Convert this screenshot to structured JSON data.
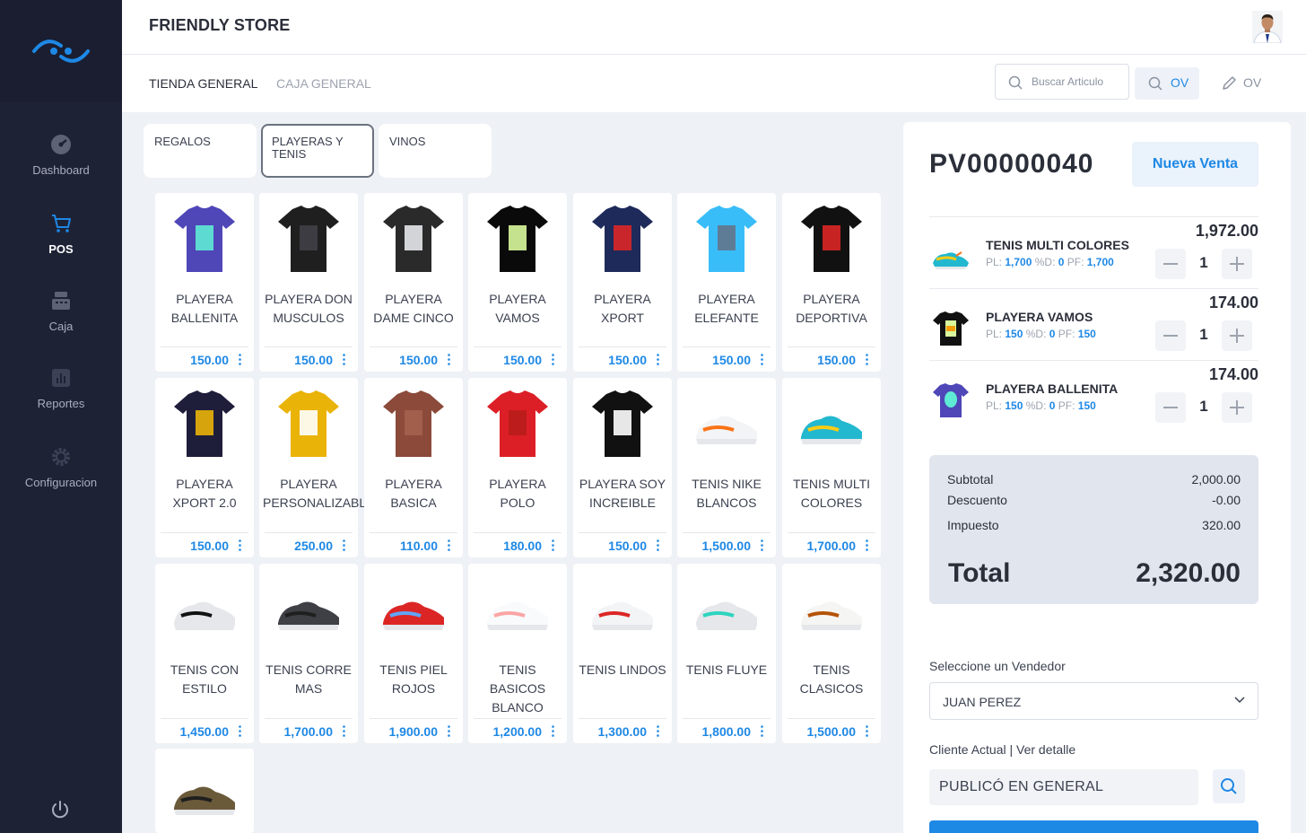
{
  "app": {
    "store_name": "FRIENDLY STORE"
  },
  "sidebar": {
    "items": [
      {
        "label": "Dashboard",
        "icon": "dashboard-icon"
      },
      {
        "label": "POS",
        "icon": "cart-icon"
      },
      {
        "label": "Caja",
        "icon": "cash-register-icon"
      },
      {
        "label": "Reportes",
        "icon": "reports-icon"
      },
      {
        "label": "Configuracion",
        "icon": "gear-icon"
      }
    ],
    "active": "POS"
  },
  "breadcrumb": {
    "store": "TIENDA GENERAL",
    "register": "CAJA GENERAL"
  },
  "toolbar": {
    "search_placeholder": "Buscar Articulo",
    "ov_search": "OV",
    "ov_edit": "OV"
  },
  "categories": [
    {
      "label": "REGALOS"
    },
    {
      "label": "PLAYERAS Y TENIS"
    },
    {
      "label": "VINOS"
    }
  ],
  "products": [
    {
      "name": "PLAYERA BALLENITA",
      "price": "150.00"
    },
    {
      "name": "PLAYERA DON MUSCULOS",
      "price": "150.00"
    },
    {
      "name": "PLAYERA DAME CINCO",
      "price": "150.00"
    },
    {
      "name": "PLAYERA VAMOS",
      "price": "150.00"
    },
    {
      "name": "PLAYERA XPORT",
      "price": "150.00"
    },
    {
      "name": "PLAYERA ELEFANTE",
      "price": "150.00"
    },
    {
      "name": "PLAYERA DEPORTIVA",
      "price": "150.00"
    },
    {
      "name": "PLAYERA XPORT 2.0",
      "price": "150.00"
    },
    {
      "name": "PLAYERA PERSONALIZABLE",
      "price": "250.00"
    },
    {
      "name": "PLAYERA BASICA",
      "price": "110.00"
    },
    {
      "name": "PLAYERA POLO",
      "price": "180.00"
    },
    {
      "name": "PLAYERA SOY INCREIBLE",
      "price": "150.00"
    },
    {
      "name": "TENIS NIKE BLANCOS",
      "price": "1,500.00"
    },
    {
      "name": "TENIS MULTI COLORES",
      "price": "1,700.00"
    },
    {
      "name": "TENIS CON ESTILO",
      "price": "1,450.00"
    },
    {
      "name": "TENIS CORRE MAS",
      "price": "1,700.00"
    },
    {
      "name": "TENIS PIEL ROJOS",
      "price": "1,900.00"
    },
    {
      "name": "TENIS BASICOS BLANCO",
      "price": "1,200.00"
    },
    {
      "name": "TENIS LINDOS",
      "price": "1,300.00"
    },
    {
      "name": "TENIS FLUYE",
      "price": "1,800.00"
    },
    {
      "name": "TENIS CLASICOS",
      "price": "1,500.00"
    },
    {
      "name": "",
      "price": ""
    }
  ],
  "order": {
    "id": "PV00000040",
    "new_sale_label": "Nueva Venta",
    "items": [
      {
        "name": "TENIS MULTI COLORES",
        "total": "1,972.00",
        "pl_label": "PL:",
        "pl": "1,700",
        "d_label": "%D:",
        "d": "0",
        "pf_label": "PF:",
        "pf": "1,700",
        "qty": "1"
      },
      {
        "name": "PLAYERA VAMOS",
        "total": "174.00",
        "pl_label": "PL:",
        "pl": "150",
        "d_label": "%D:",
        "d": "0",
        "pf_label": "PF:",
        "pf": "150",
        "qty": "1"
      },
      {
        "name": "PLAYERA BALLENITA",
        "total": "174.00",
        "pl_label": "PL:",
        "pl": "150",
        "d_label": "%D:",
        "d": "0",
        "pf_label": "PF:",
        "pf": "150",
        "qty": "1"
      }
    ],
    "summary": {
      "subtotal_label": "Subtotal",
      "subtotal": "2,000.00",
      "discount_label": "Descuento",
      "discount": "-0.00",
      "tax_label": "Impuesto",
      "tax": "320.00",
      "total_label": "Total",
      "total": "2,320.00"
    },
    "vendor_label": "Seleccione un Vendedor",
    "vendor_value": "JUAN PEREZ",
    "client_label": "Cliente Actual | Ver detalle",
    "client_value": "PUBLICÓ EN GENERAL"
  },
  "colors": {
    "accent": "#1e88e5",
    "sidebar": "#1e2235",
    "background": "#eef1f5"
  }
}
